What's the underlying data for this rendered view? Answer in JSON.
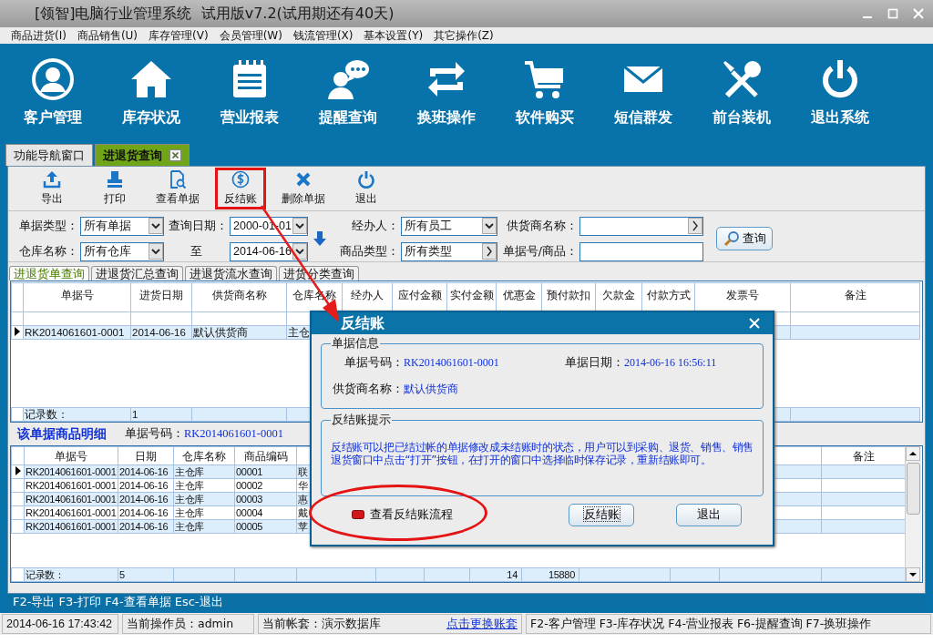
{
  "window": {
    "title": "[领智]电脑行业管理系统  试用版v7.2(试用期还有40天)"
  },
  "menu": [
    {
      "label": "商品进货(I)"
    },
    {
      "label": "商品销售(U)"
    },
    {
      "label": "库存管理(V)"
    },
    {
      "label": "会员管理(W)"
    },
    {
      "label": "钱流管理(X)"
    },
    {
      "label": "基本设置(Y)"
    },
    {
      "label": "其它操作(Z)"
    }
  ],
  "nav_toolbar": [
    {
      "label": "客户管理"
    },
    {
      "label": "库存状况"
    },
    {
      "label": "营业报表"
    },
    {
      "label": "提醒查询"
    },
    {
      "label": "换班操作"
    },
    {
      "label": "软件购买"
    },
    {
      "label": "短信群发"
    },
    {
      "label": "前台装机"
    },
    {
      "label": "退出系统"
    }
  ],
  "tabs": [
    {
      "label": "功能导航窗口",
      "selected": false,
      "closable": false
    },
    {
      "label": "进退货查询",
      "selected": true,
      "closable": true
    }
  ],
  "actions": [
    {
      "label": "导出",
      "highlighted": false
    },
    {
      "label": "打印",
      "highlighted": false
    },
    {
      "label": "查看单据",
      "highlighted": false
    },
    {
      "label": "反结账",
      "highlighted": true
    },
    {
      "label": "删除单据",
      "highlighted": false
    },
    {
      "label": "退出",
      "highlighted": false
    }
  ],
  "filters": [
    {
      "label": "单据类型：",
      "value": "所有单据",
      "kind": "dropdown"
    },
    {
      "label": "查询日期：",
      "value": "2000-01-01",
      "kind": "dropdown"
    },
    {
      "label": "经办人：",
      "value": "所有员工",
      "kind": "dropdown"
    },
    {
      "label": "供货商名称：",
      "kind": "picker"
    },
    {
      "label": "仓库名称：",
      "value": "所有仓库",
      "kind": "dropdown"
    },
    {
      "label": "至",
      "value": "2014-06-16",
      "kind": "dropdown"
    },
    {
      "label": "商品类型：",
      "value": "所有类型",
      "kind": "picker"
    },
    {
      "label": "单据号/商品：",
      "kind": "text"
    }
  ],
  "query_button": "查询",
  "subtabs": [
    {
      "label": "进退货单查询",
      "selected": true
    },
    {
      "label": "进退货汇总查询",
      "selected": false
    },
    {
      "label": "进退货流水查询",
      "selected": false
    },
    {
      "label": "进货分类查询",
      "selected": false
    }
  ],
  "bill_table": {
    "columns": [
      {
        "label": "单据号"
      },
      {
        "label": "进货日期"
      },
      {
        "label": "供货商名称"
      },
      {
        "label": "仓库名称"
      },
      {
        "label": "经办人"
      },
      {
        "label": "应付金额"
      },
      {
        "label": "实付金额"
      },
      {
        "label": "优惠金"
      },
      {
        "label": "预付款扣"
      },
      {
        "label": "欠款金"
      },
      {
        "label": "付款方式"
      },
      {
        "label": "发票号"
      },
      {
        "label": "备注"
      }
    ],
    "rows": [
      {
        "current": true,
        "cells": [
          "RK2014061601-0001",
          "2014-06-16",
          "默认供货商",
          "主仓"
        ]
      }
    ],
    "footer": {
      "label": "记录数：",
      "count": "1"
    }
  },
  "detail": {
    "title": "该单据商品明细",
    "bill_no_label": "单据号码：",
    "bill_no": "RK2014061601-0001"
  },
  "detail_table": {
    "columns": [
      {
        "label": "单据号"
      },
      {
        "label": "日期"
      },
      {
        "label": "仓库名称"
      },
      {
        "label": "商品编码"
      },
      {},
      {},
      {},
      {},
      {},
      {},
      {},
      {},
      {
        "label": "备注"
      }
    ],
    "rows": [
      {
        "current": true,
        "cells": [
          "RK2014061601-0001",
          "2014-06-16",
          "主仓库",
          "00001",
          "联"
        ]
      },
      {
        "current": false,
        "cells": [
          "RK2014061601-0001",
          "2014-06-16",
          "主仓库",
          "00002",
          "华"
        ]
      },
      {
        "current": false,
        "cells": [
          "RK2014061601-0001",
          "2014-06-16",
          "主仓库",
          "00003",
          "惠"
        ]
      },
      {
        "current": false,
        "cells": [
          "RK2014061601-0001",
          "2014-06-16",
          "主仓库",
          "00004",
          "戴"
        ]
      },
      {
        "current": false,
        "cells": [
          "RK2014061601-0001",
          "2014-06-16",
          "主仓库",
          "00005",
          "苹"
        ]
      }
    ],
    "footer": {
      "label": "记录数：",
      "count": "5",
      "column_8": "14",
      "column_9": "15880"
    }
  },
  "shortcut_bar": "F2-导出 F3-打印 F4-查看单据 Esc-退出",
  "status_bar": {
    "datetime": "2014-06-16 17:43:42",
    "operator": "当前操作员：admin",
    "account": "当前帐套：演示数据库",
    "switch_link": "点击更换账套",
    "shortcuts": "F2-客户管理 F3-库存状况 F4-营业报表 F6-提醒查询 F7-换班操作"
  },
  "dialog": {
    "title": "反结账",
    "info_group": {
      "title": "单据信息",
      "fields": [
        {
          "label": "单据号码：",
          "value": "RK2014061601-0001"
        },
        {
          "label": "单据日期：",
          "value": "2014-06-16 16:56:11"
        },
        {
          "label": "供货商名称：",
          "value": "默认供货商"
        }
      ]
    },
    "hint_group": {
      "title": "反结账提示",
      "text": "反结账可以把已结过帐的单据修改成未结账时的状态，用户可以到采购、退货、销售、销售退货窗口中点击“打开”按钮，在打开的窗口中选择临时保存记录，重新结账即可。"
    },
    "flow_link": {
      "label": "查看反结账流程",
      "circled": true
    },
    "buttons": [
      {
        "label": "反结账",
        "focused": true
      },
      {
        "label": "退出",
        "focused": false
      }
    ]
  }
}
